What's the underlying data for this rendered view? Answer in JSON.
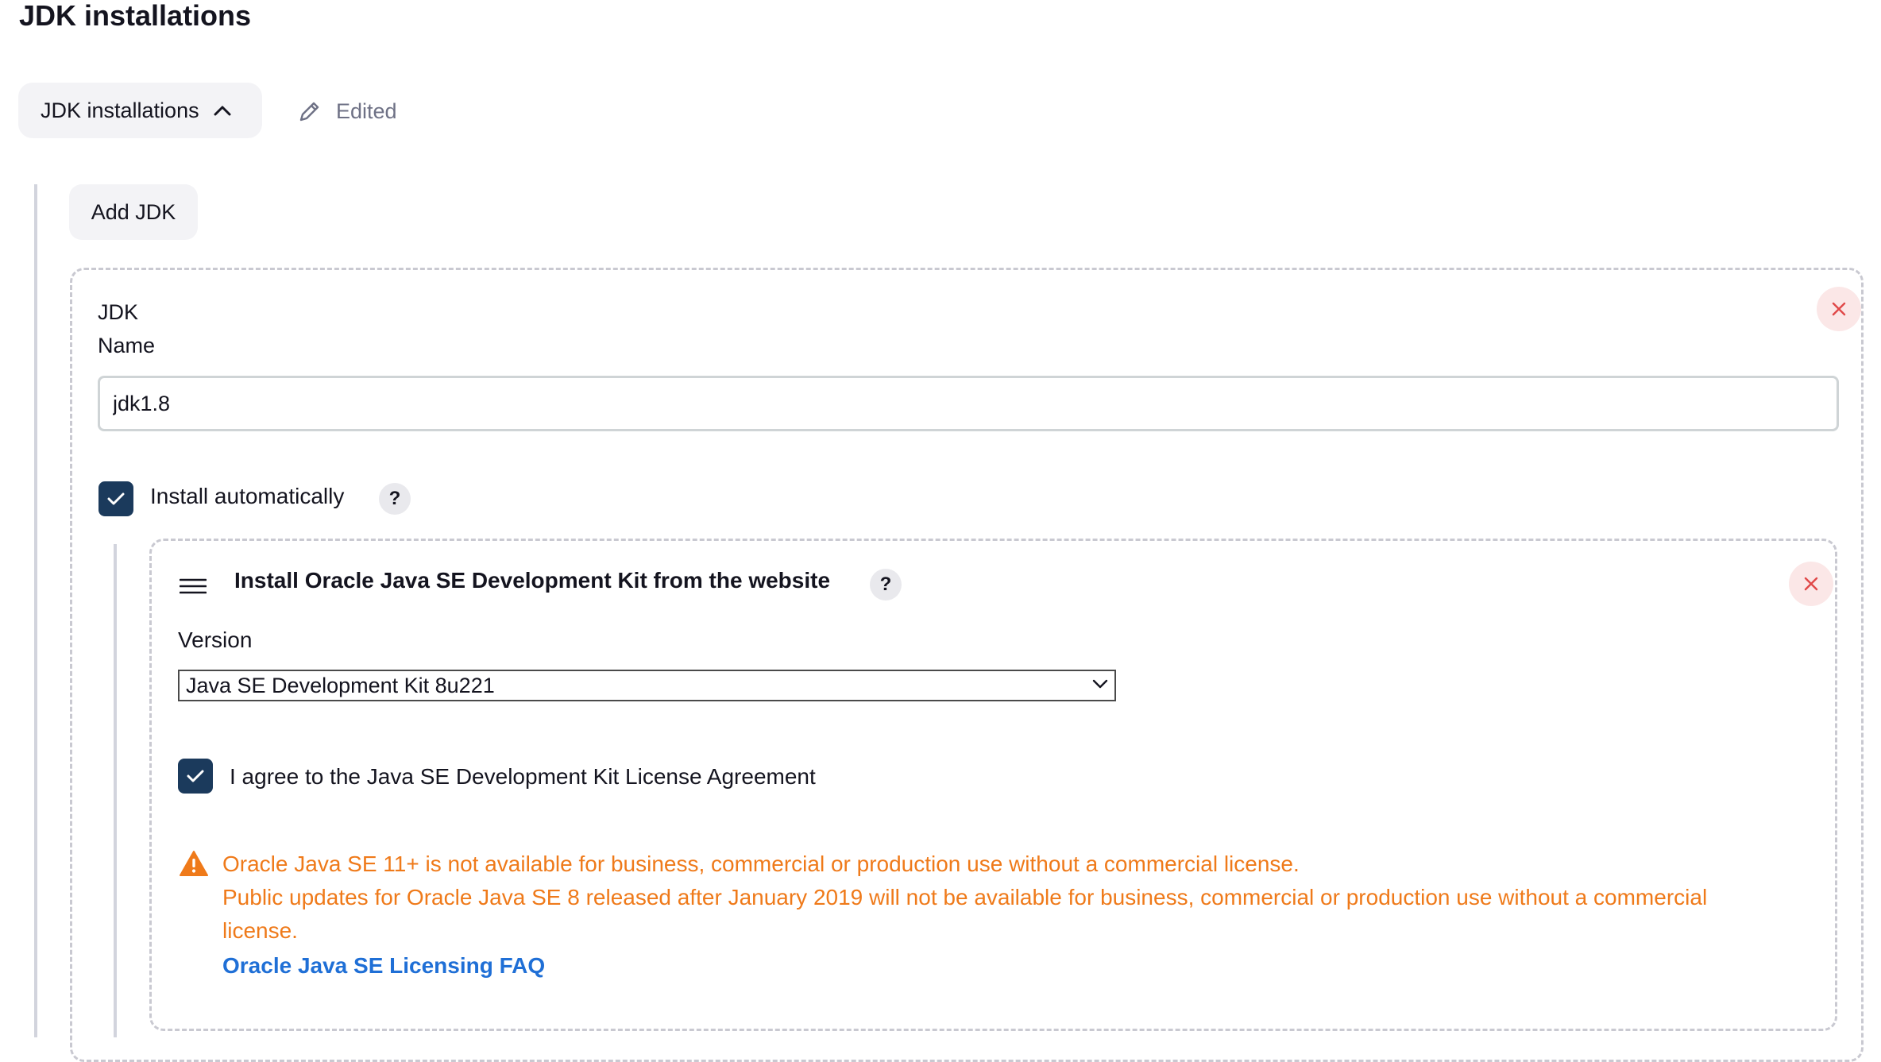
{
  "page": {
    "title": "JDK installations"
  },
  "toggle": {
    "label": "JDK installations",
    "icon": "chevron-up-icon"
  },
  "status": {
    "label": "Edited",
    "icon": "pencil-icon"
  },
  "add_button": {
    "label": "Add JDK"
  },
  "jdk": {
    "section_label": "JDK",
    "name_label": "Name",
    "name_value": "jdk1.8",
    "install_automatically": {
      "label": "Install automatically",
      "checked": true,
      "help": "?"
    },
    "installer": {
      "title": "Install Oracle Java SE Development Kit from the website",
      "help": "?",
      "version_label": "Version",
      "version_selected": "Java SE Development Kit 8u221",
      "agree_label": "I agree to the Java SE Development Kit License Agreement",
      "agree_checked": true,
      "warning_line1": "Oracle Java SE 11+ is not available for business, commercial or production use without a commercial license.",
      "warning_line2": "Public updates for Oracle Java SE 8 released after January 2019 will not be available for business, commercial or production use without a commercial",
      "warning_line3": "license.",
      "faq_link": "Oracle Java SE Licensing FAQ"
    }
  },
  "colors": {
    "checkbox": "#1b3a5c",
    "warning": "#ef7a1a",
    "link": "#1f6fd6",
    "close": "#e04848"
  }
}
